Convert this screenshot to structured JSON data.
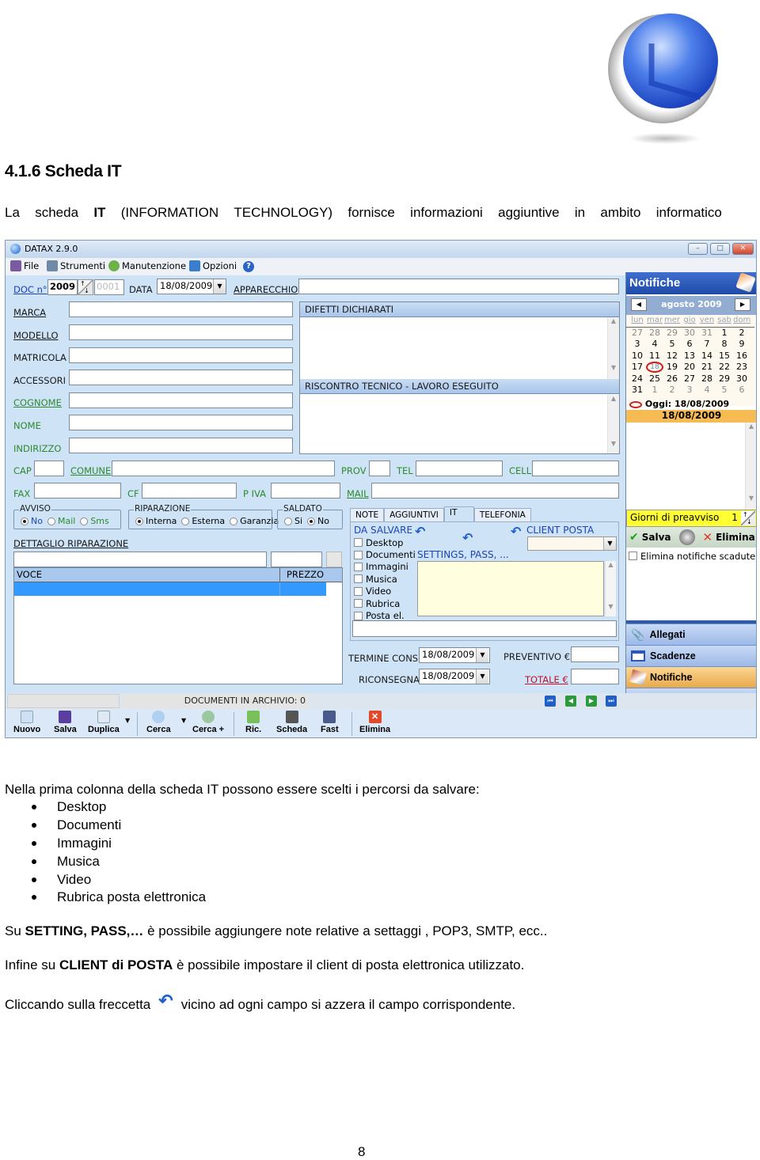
{
  "document": {
    "heading": "4.1.6 Scheda IT",
    "intro_words": [
      "La",
      "scheda",
      "IT",
      "(INFORMATION",
      "TECHNOLOGY)",
      "fornisce",
      "informazioni",
      "aggiuntive",
      "in",
      "ambito",
      "informatico"
    ],
    "para1": "Nella prima colonna della scheda IT possono essere scelti i percorsi da salvare:",
    "bullets": [
      "Desktop",
      "Documenti",
      "Immagini",
      "Musica",
      "Video",
      "Rubrica posta elettronica"
    ],
    "para2_prefix": "Su ",
    "para2_bold": "SETTING, PASS,…",
    "para2_rest": " è possibile aggiungere note relative a settaggi , POP3, SMTP, ecc..",
    "para3_prefix": "Infine su ",
    "para3_bold": "CLIENT di POSTA",
    "para3_rest": " è possibile impostare il client di posta elettronica utilizzato.",
    "para4_prefix": "Cliccando sulla freccetta",
    "para4_rest": "vicino ad ogni campo si azzera il campo corrispondente.",
    "page_number": "8"
  },
  "window": {
    "title": "DATAX 2.9.0",
    "controls": {
      "minimize": "–",
      "maximize": "□",
      "close": "✕"
    },
    "menu": [
      {
        "label": "File",
        "icon": "file-icon"
      },
      {
        "label": "Strumenti",
        "icon": "tools-icon"
      },
      {
        "label": "Manutenzione",
        "icon": "maintenance-icon"
      },
      {
        "label": "Opzioni",
        "icon": "options-icon"
      }
    ],
    "help_icon": "?"
  },
  "form": {
    "doc_label": "DOC n°",
    "doc_year": "2009",
    "doc_number": "0001",
    "data_label": "DATA",
    "data_value": "18/08/2009",
    "apparecchio_label": "APPARECCHIO",
    "fields_left": [
      {
        "label": "MARCA",
        "value": ""
      },
      {
        "label": "MODELLO",
        "value": ""
      },
      {
        "label": "MATRICOLA",
        "value": ""
      },
      {
        "label": "ACCESSORI",
        "value": ""
      },
      {
        "label": "COGNOME",
        "value": ""
      },
      {
        "label": "NOME",
        "value": ""
      },
      {
        "label": "INDIRIZZO",
        "value": ""
      }
    ],
    "difetti_header": "DIFETTI DICHIARATI",
    "riscontro_header": "RISCONTRO TECNICO - LAVORO ESEGUITO",
    "cap_label": "CAP",
    "comune_label": "COMUNE",
    "prov_label": "PROV",
    "tel_label": "TEL",
    "cell_label": "CELL",
    "fax_label": "FAX",
    "cf_label": "CF",
    "piva_label": "P IVA",
    "mail_label": "MAIL",
    "avviso": {
      "title": "AVVISO",
      "options": [
        "No",
        "Mail",
        "Sms"
      ],
      "selected": "No"
    },
    "riparazione": {
      "title": "RIPARAZIONE",
      "options": [
        "Interna",
        "Esterna",
        "Garanzia"
      ],
      "selected": "Interna"
    },
    "saldato": {
      "title": "SALDATO",
      "options": [
        "Si",
        "No"
      ],
      "selected": "No"
    },
    "dettaglio_label": "DETTAGLIO RIPARAZIONE",
    "table_headers": [
      "VOCE",
      "PREZZO"
    ],
    "tabs": [
      "NOTE",
      "AGGIUNTIVI",
      "IT",
      "TELEFONIA"
    ],
    "active_tab": "IT",
    "it": {
      "da_salvare": "DA SALVARE",
      "checkboxes": [
        "Desktop",
        "Documenti",
        "Immagini",
        "Musica",
        "Video",
        "Rubrica",
        "Posta el."
      ],
      "settings_label": "SETTINGS, PASS, ...",
      "client_posta_label": "CLIENT POSTA",
      "client_posta_value": ""
    },
    "termine_cons_label": "TERMINE CONS",
    "termine_cons_value": "18/08/2009",
    "riconsegna_label": "RICONSEGNA",
    "riconsegna_value": "18/08/2009",
    "preventivo_label": "PREVENTIVO €",
    "totale_label": "TOTALE €"
  },
  "notifiche": {
    "title": "Notifiche",
    "month": "agosto 2009",
    "weekdays": [
      "lun",
      "mar",
      "mer",
      "gio",
      "ven",
      "sab",
      "dom"
    ],
    "weeks": [
      [
        "27",
        "28",
        "29",
        "30",
        "31",
        "1",
        "2"
      ],
      [
        "3",
        "4",
        "5",
        "6",
        "7",
        "8",
        "9"
      ],
      [
        "10",
        "11",
        "12",
        "13",
        "14",
        "15",
        "16"
      ],
      [
        "17",
        "18",
        "19",
        "20",
        "21",
        "22",
        "23"
      ],
      [
        "24",
        "25",
        "26",
        "27",
        "28",
        "29",
        "30"
      ],
      [
        "31",
        "1",
        "2",
        "3",
        "4",
        "5",
        "6"
      ]
    ],
    "today_label": "Oggi: 18/08/2009",
    "selected_date": "18/08/2009",
    "preavviso_label": "Giorni di preavviso",
    "preavviso_value": "1",
    "salva_label": "Salva",
    "elimina_label": "Elimina",
    "elimina_scadute_label": "Elimina notifiche scadute",
    "nav": [
      {
        "label": "Allegati",
        "icon": "paperclip-icon"
      },
      {
        "label": "Scadenze",
        "icon": "calendar-icon"
      },
      {
        "label": "Notifiche",
        "icon": "notification-icon"
      }
    ]
  },
  "status": {
    "documenti_archivio": "DOCUMENTI IN ARCHIVIO: 0"
  },
  "toolbar": [
    {
      "label": "Nuovo",
      "icon": "new-document-icon",
      "color": "#cfe0f5"
    },
    {
      "label": "Salva",
      "icon": "floppy-icon",
      "color": "#5a3fa0"
    },
    {
      "label": "Duplica",
      "icon": "copy-icon",
      "color": "#dfe8f3"
    },
    {
      "label": "Cerca",
      "icon": "search-icon",
      "color": "#b0d0f0"
    },
    {
      "label": "Cerca +",
      "icon": "search-plus-icon",
      "color": "#9cc8a0"
    },
    {
      "label": "Ric.",
      "icon": "check-edit-icon",
      "color": "#7ac05a"
    },
    {
      "label": "Scheda",
      "icon": "printer-icon",
      "color": "#555"
    },
    {
      "label": "Fast",
      "icon": "fast-print-icon",
      "color": "#4a5a8a"
    },
    {
      "label": "Elimina",
      "icon": "delete-icon",
      "color": "#e04a2a"
    }
  ]
}
